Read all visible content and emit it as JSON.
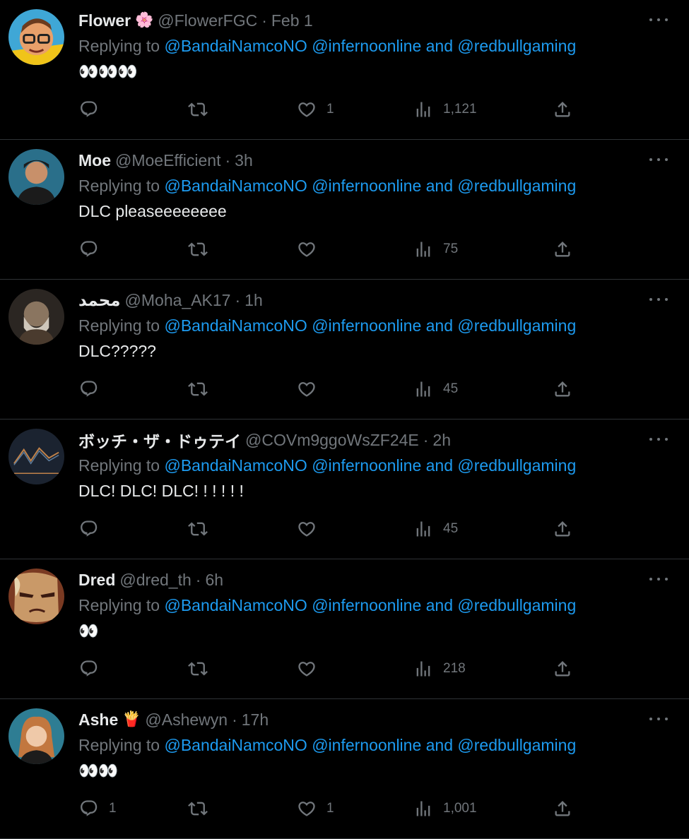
{
  "replying_label": "Replying to",
  "mentions": [
    "@BandaiNamcoNO",
    "@infernoonline",
    "and",
    "@redbullgaming"
  ],
  "colors": {
    "background": "#000000",
    "text": "#e7e9ea",
    "muted": "#71767b",
    "link": "#1d9bf0",
    "divider": "#2f3336"
  },
  "tweets": [
    {
      "name": "Flower",
      "badge": "🌸",
      "handle": "@FlowerFGC",
      "time": "Feb 1",
      "text": "👀👀👀",
      "replies": "",
      "retweets": "",
      "likes": "1",
      "views": "1,121",
      "avatar_icon": "glasses-cartoon-avatar"
    },
    {
      "name": "Moe",
      "badge": "",
      "handle": "@MoeEfficient",
      "time": "3h",
      "text": "DLC pleaseeeeeeee",
      "replies": "",
      "retweets": "",
      "likes": "",
      "views": "75",
      "avatar_icon": "person-photo-avatar"
    },
    {
      "name": "محمد",
      "badge": "",
      "handle": "@Moha_AK17",
      "time": "1h",
      "text": "DLC?????",
      "replies": "",
      "retweets": "",
      "likes": "",
      "views": "45",
      "avatar_icon": "warrior-art-avatar"
    },
    {
      "name": "ボッチ・ザ・ドゥテイ",
      "badge": "",
      "handle": "@COVm9ggoWsZF24E",
      "time": "2h",
      "text": "DLC!  DLC!  DLC!  !  !  !  !  !",
      "replies": "",
      "retweets": "",
      "likes": "",
      "views": "45",
      "avatar_icon": "chart-avatar"
    },
    {
      "name": "Dred",
      "badge": "",
      "handle": "@dred_th",
      "time": "6h",
      "text": "👀",
      "replies": "",
      "retweets": "",
      "likes": "",
      "views": "218",
      "avatar_icon": "anime-face-avatar"
    },
    {
      "name": "Ashe",
      "badge": "🍟",
      "handle": "@Ashewyn",
      "time": "17h",
      "text": "👀👀",
      "replies": "1",
      "retweets": "",
      "likes": "1",
      "views": "1,001",
      "avatar_icon": "woman-photo-avatar"
    }
  ]
}
